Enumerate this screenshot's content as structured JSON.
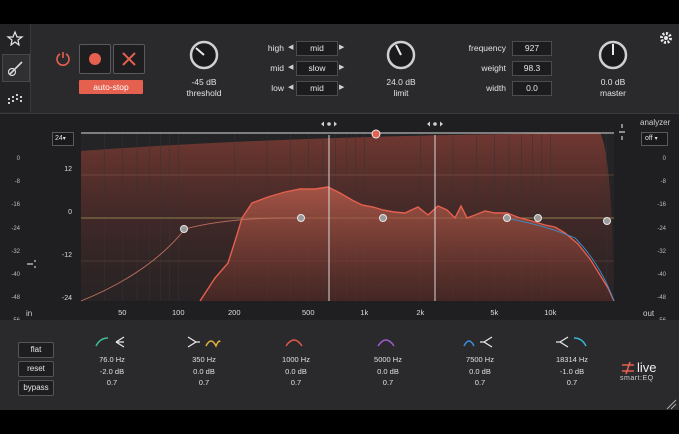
{
  "toolbar": {
    "auto_stop_label": "auto-stop",
    "threshold": {
      "value": "-45 dB",
      "label": "threshold"
    },
    "limit": {
      "value": "24.0 dB",
      "label": "limit"
    },
    "master": {
      "value": "0.0 dB",
      "label": "master"
    },
    "speed": [
      {
        "label": "high",
        "value": "mid"
      },
      {
        "label": "mid",
        "value": "slow"
      },
      {
        "label": "low",
        "value": "mid"
      }
    ],
    "params": [
      {
        "label": "frequency",
        "value": "927"
      },
      {
        "label": "weight",
        "value": "98.3"
      },
      {
        "label": "width",
        "value": "0.0"
      }
    ]
  },
  "graph": {
    "range_label": "24",
    "analyzer": {
      "label": "analyzer",
      "value": "off"
    },
    "y_ticks": [
      "12",
      "0",
      "-12",
      "-24"
    ],
    "x_ticks": [
      "50",
      "100",
      "200",
      "500",
      "1k",
      "2k",
      "5k",
      "10k"
    ],
    "in_label": "in",
    "out_label": "out",
    "meter_ticks": [
      "0",
      "-8",
      "-16",
      "-24",
      "-32",
      "-40",
      "-48",
      "-56"
    ]
  },
  "bottom": {
    "flat_label": "flat",
    "reset_label": "reset",
    "bypass_label": "bypass",
    "bands": [
      {
        "freq": "76.0 Hz",
        "gain": "-2.0 dB",
        "q": "0.7",
        "color": "#3fbf8f"
      },
      {
        "freq": "350 Hz",
        "gain": "0.0 dB",
        "q": "0.7",
        "color": "#e0b53a"
      },
      {
        "freq": "1000 Hz",
        "gain": "0.0 dB",
        "q": "0.7",
        "color": "#e0584a"
      },
      {
        "freq": "5000 Hz",
        "gain": "0.0 dB",
        "q": "0.7",
        "color": "#a05ad0"
      },
      {
        "freq": "7500 Hz",
        "gain": "0.0 dB",
        "q": "0.7",
        "color": "#3a8fe0"
      },
      {
        "freq": "18314 Hz",
        "gain": "-1.0 dB",
        "q": "0.7",
        "color": "#3ab5d8"
      }
    ]
  },
  "brand": {
    "name": "live",
    "sub": "smart:EQ"
  },
  "colors": {
    "accent": "#e5604f",
    "curve_fill": "#b0503f",
    "panel": "#2a2a2c"
  }
}
